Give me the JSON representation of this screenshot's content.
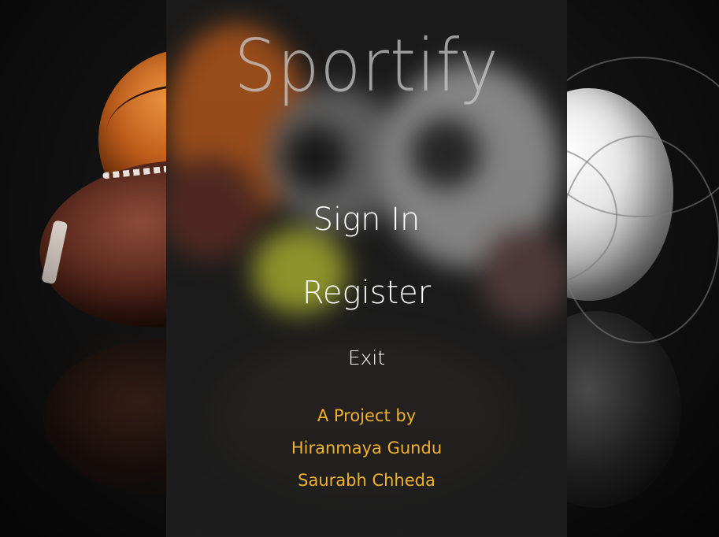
{
  "app": {
    "title": "Sportify"
  },
  "menu": {
    "sign_in": "Sign In",
    "register": "Register",
    "exit": "Exit"
  },
  "credits": {
    "heading": "A Project by",
    "authors": [
      "Hiranmaya Gundu",
      "Saurabh Chheda"
    ]
  },
  "colors": {
    "menu_text": "#ffffff",
    "credit_text": "#f0b02a",
    "title_text": "#c8c8c8",
    "panel_bg": "#1c1c1c",
    "background": "#050505"
  },
  "background_images": [
    "basketball",
    "american-football",
    "volleyball",
    "tennis-ball"
  ]
}
